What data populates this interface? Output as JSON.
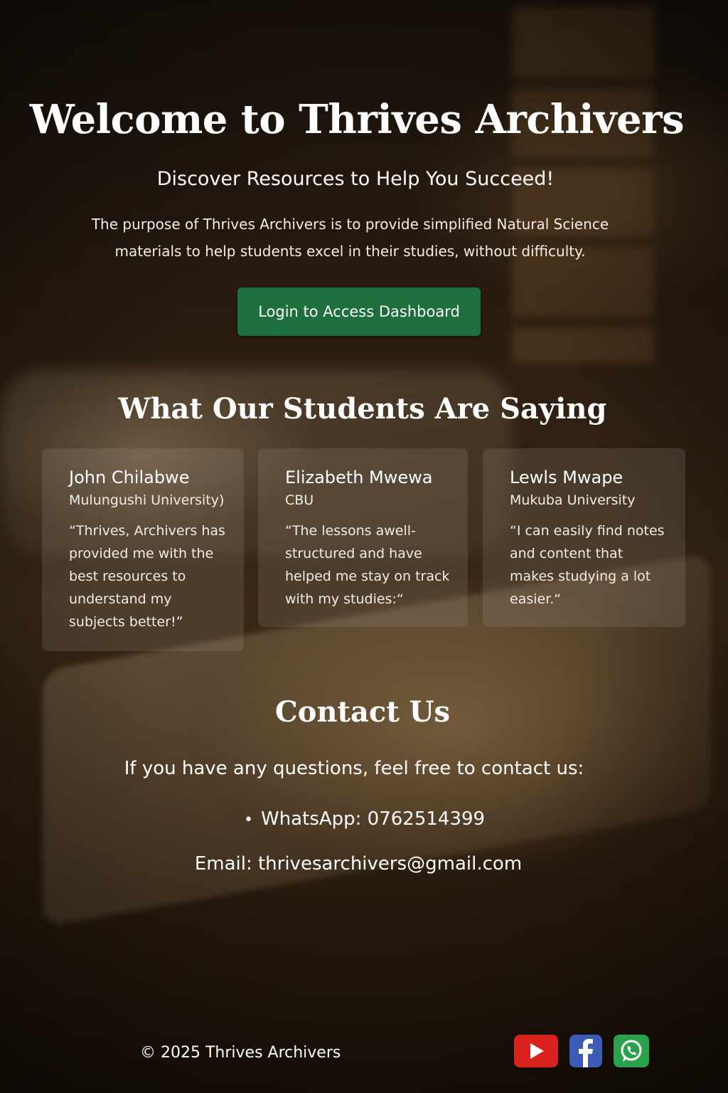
{
  "hero": {
    "title": "Welcome to Thrives Archivers",
    "subtitle": "Discover Resources to Help You Succeed!",
    "description": "The purpose of Thrives Archivers is to provide simplified Natural Science materials to help students excel in their studies, without difficulty.",
    "login_label": "Login to Access Dashboard"
  },
  "testimonials": {
    "title": "What Our Students Are Saying",
    "items": [
      {
        "name": "John Chilabwe",
        "school": "Mulungushi University)",
        "quote": "“Thrives, Archivers has provided me with the best resources to understand my subjects better!”"
      },
      {
        "name": "Elizabeth Mwewa",
        "school": "CBU",
        "quote": "“The lessons awell-structured and have helped me stay on track with my studies:“"
      },
      {
        "name": "Lewls Mwape",
        "school": "Mukuba University",
        "quote": "“I can easily find notes and content that makes studying a lot easier.“"
      }
    ]
  },
  "contact": {
    "title": "Contact Us",
    "intro": "If you have any questions, feel free to contact us:",
    "whatsapp": "WhatsApp: 0762514399",
    "email": "Email: thrivesarchivers@gmail.com"
  },
  "footer": {
    "copyright": "© 2025 Thrives Archivers",
    "social_icons": [
      "youtube-icon",
      "facebook-icon",
      "whatsapp-icon"
    ]
  },
  "colors": {
    "button_green": "#1e6f3d",
    "youtube_red": "#d8201c",
    "facebook_blue": "#3b5bb5",
    "whatsapp_green": "#29a24a"
  }
}
